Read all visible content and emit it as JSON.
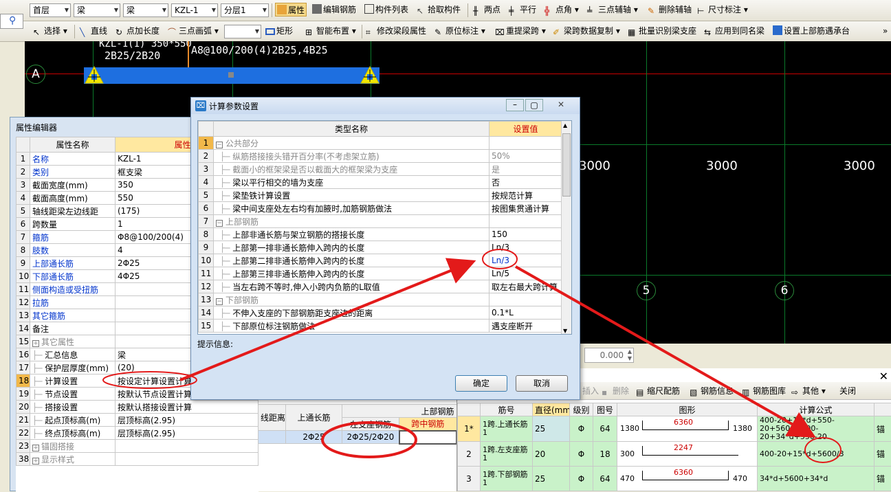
{
  "toolbar1": {
    "combo_floor": "首层",
    "combo_type1": "梁",
    "combo_type2": "梁",
    "combo_element": "KZL-1",
    "combo_layer": "分层1",
    "items": [
      "属性",
      "编辑钢筋",
      "构件列表",
      "拾取构件",
      "两点",
      "平行",
      "点角",
      "三点辅轴",
      "删除辅轴",
      "尺寸标注"
    ]
  },
  "toolbar2": {
    "items": [
      "选择",
      "直线",
      "点加长度",
      "三点画弧",
      "矩形",
      "智能布置",
      "修改梁段属性",
      "原位标注",
      "重提梁跨",
      "梁跨数据复制",
      "批量识别梁支座",
      "应用到同名梁",
      "设置上部筋遇承台"
    ],
    "more": "»"
  },
  "cad": {
    "label_top_left": "2B25/2B20",
    "label_cut": "KZL-1(1) 350*550",
    "label_line2": "A8@100/200(4)2B25,4B25",
    "axis_a": "A",
    "dim_left": "3000",
    "dim_1": "3000",
    "dim_2": "3000",
    "axis_5": "5",
    "axis_6": "6",
    "coord_value": "0.000"
  },
  "prop_editor": {
    "title": "属性编辑器",
    "col_name": "属性名称",
    "col_value": "属性值",
    "rows": [
      {
        "n": "1",
        "name": "名称",
        "value": "KZL-1",
        "blue": true
      },
      {
        "n": "2",
        "name": "类别",
        "value": "框支梁",
        "blue": true
      },
      {
        "n": "3",
        "name": "截面宽度(mm)",
        "value": "350",
        "blue": false
      },
      {
        "n": "4",
        "name": "截面高度(mm)",
        "value": "550",
        "blue": false
      },
      {
        "n": "5",
        "name": "轴线距梁左边线距",
        "value": "(175)",
        "blue": false
      },
      {
        "n": "6",
        "name": "跨数量",
        "value": "1",
        "blue": false
      },
      {
        "n": "7",
        "name": "箍筋",
        "value": "Φ8@100/200(4)",
        "blue": true
      },
      {
        "n": "8",
        "name": "肢数",
        "value": "4",
        "blue": true
      },
      {
        "n": "9",
        "name": "上部通长筋",
        "value": "2Φ25",
        "blue": true
      },
      {
        "n": "10",
        "name": "下部通长筋",
        "value": "4Φ25",
        "blue": true
      },
      {
        "n": "11",
        "name": "侧面构造或受扭筋",
        "value": "",
        "blue": true
      },
      {
        "n": "12",
        "name": "拉筋",
        "value": "",
        "blue": true
      },
      {
        "n": "13",
        "name": "其它箍筋",
        "value": "",
        "blue": true
      },
      {
        "n": "14",
        "name": "备注",
        "value": "",
        "blue": false
      },
      {
        "n": "15",
        "name": "其它属性",
        "value": "",
        "blue": false,
        "group": true
      },
      {
        "n": "16",
        "name": "汇总信息",
        "value": "梁",
        "blue": false,
        "sub": true
      },
      {
        "n": "17",
        "name": "保护层厚度(mm)",
        "value": "(20)",
        "blue": false,
        "sub": true
      },
      {
        "n": "18",
        "name": "计算设置",
        "value": "按设定计算设置计算",
        "blue": false,
        "sub": true,
        "sel": true
      },
      {
        "n": "19",
        "name": "节点设置",
        "value": "按默认节点设置计算",
        "blue": false,
        "sub": true
      },
      {
        "n": "20",
        "name": "搭接设置",
        "value": "按默认搭接设置计算",
        "blue": false,
        "sub": true
      },
      {
        "n": "21",
        "name": "起点顶标高(m)",
        "value": "层顶标高(2.95)",
        "blue": false,
        "sub": true
      },
      {
        "n": "22",
        "name": "终点顶标高(m)",
        "value": "层顶标高(2.95)",
        "blue": false,
        "sub": true
      },
      {
        "n": "23",
        "name": "锚固搭接",
        "value": "",
        "blue": false,
        "group": true
      },
      {
        "n": "38",
        "name": "显示样式",
        "value": "",
        "blue": false,
        "group": true
      }
    ]
  },
  "dialog": {
    "title": "计算参数设置",
    "col_type": "类型名称",
    "col_value": "设置值",
    "rows": [
      {
        "n": "1",
        "name": "公共部分",
        "value": "",
        "group": true
      },
      {
        "n": "2",
        "name": "纵筋搭接接头错开百分率(不考虑架立筋)",
        "value": "50%",
        "gray": true
      },
      {
        "n": "3",
        "name": "截面小的框架梁是否以截面大的框架梁为支座",
        "value": "是",
        "gray": true
      },
      {
        "n": "4",
        "name": "梁以平行相交的墙为支座",
        "value": "否"
      },
      {
        "n": "5",
        "name": "梁垫铁计算设置",
        "value": "按规范计算"
      },
      {
        "n": "6",
        "name": "梁中间支座处左右均有加腋时,加筋钢筋做法",
        "value": "按图集贯通计算"
      },
      {
        "n": "7",
        "name": "上部钢筋",
        "value": "",
        "group": true
      },
      {
        "n": "8",
        "name": "上部非通长筋与架立钢筋的搭接长度",
        "value": "150"
      },
      {
        "n": "9",
        "name": "上部第一排非通长筋伸入跨内的长度",
        "value": "Ln/3"
      },
      {
        "n": "10",
        "name": "上部第二排非通长筋伸入跨内的长度",
        "value": "Ln/3",
        "blue": true
      },
      {
        "n": "11",
        "name": "上部第三排非通长筋伸入跨内的长度",
        "value": "Ln/5"
      },
      {
        "n": "12",
        "name": "当左右跨不等时,伸入小跨内负筋的L取值",
        "value": "取左右最大跨计算"
      },
      {
        "n": "13",
        "name": "下部钢筋",
        "value": "",
        "group": true
      },
      {
        "n": "14",
        "name": "不伸入支座的下部钢筋距支座边的距离",
        "value": "0.1*L"
      },
      {
        "n": "15",
        "name": "下部原位标注钢筋做法",
        "value": "遇支座断开"
      }
    ],
    "hint_label": "提示信息:",
    "ok": "确定",
    "cancel": "取消"
  },
  "span_table": {
    "col_dist": "线距离",
    "col_top_through": "上通长筋",
    "col_upper": "上部钢筋",
    "col_left_support": "左支座钢筋",
    "col_mid": "跨中钢筋",
    "row_through": "2Φ25",
    "row_left": "2Φ25/2Φ20"
  },
  "rebar_toolbar": {
    "items": [
      "插入",
      "删除",
      "缩尺配筋",
      "钢筋信息",
      "钢筋图库",
      "其他",
      "关闭"
    ]
  },
  "rebar_table": {
    "cols": [
      "筋号",
      "直径(mm)",
      "级别",
      "图号",
      "图形",
      "计算公式"
    ],
    "rows": [
      {
        "n": "1*",
        "name": "1跨.上通长筋1",
        "dia": "25",
        "grade": "Φ",
        "fig": "64",
        "left": "1380",
        "mid": "6360",
        "right": "1380",
        "formula": "400-20+15*d+550-20+5600+400-20+34*d+550-20"
      },
      {
        "n": "2",
        "name": "1跨.左支座筋1",
        "dia": "20",
        "grade": "Φ",
        "fig": "18",
        "left": "300",
        "mid": "2247",
        "right": "",
        "formula": "400-20+15*d+5600/3"
      },
      {
        "n": "3",
        "name": "1跨.下部钢筋1",
        "dia": "25",
        "grade": "Φ",
        "fig": "64",
        "left": "470",
        "mid": "6360",
        "right": "470",
        "formula": "34*d+5600+34*d"
      }
    ],
    "extra_col": "锚"
  },
  "colors": {
    "accent_red": "#e31a1a",
    "beam_blue": "#1e6fe0",
    "selected_yellow": "#ffe8a0",
    "green_row": "#c9f2c9"
  }
}
